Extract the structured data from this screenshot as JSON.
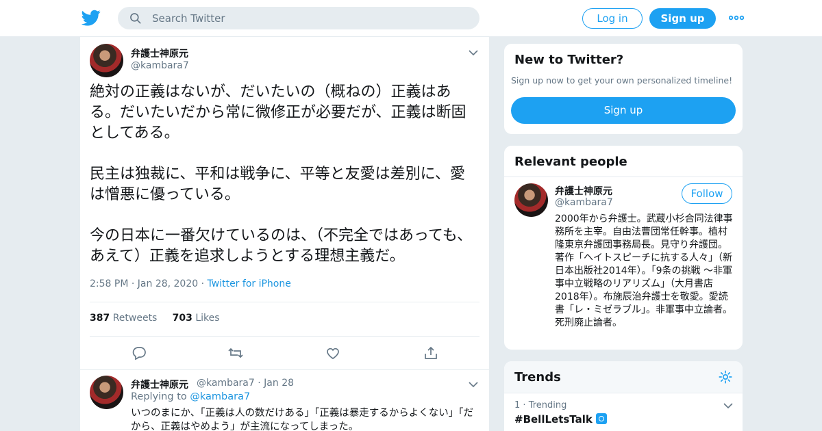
{
  "header": {
    "search_placeholder": "Search Twitter",
    "login_label": "Log in",
    "signup_label": "Sign up"
  },
  "tweet": {
    "author_name": "弁護士神原元",
    "author_handle": "@kambara7",
    "paragraphs": [
      "絶対の正義はないが、だいたいの（概ねの）正義はある。だいたいだから常に微修正が必要だが、正義は断固としてある。",
      "民主は独裁に、平和は戦争に、平等と友愛は差別に、愛は憎悪に優っている。",
      "今の日本に一番欠けているのは、（不完全ではあっても、あえて）正義を追求しようとする理想主義だ。"
    ],
    "time": "2:58 PM",
    "date": "Jan 28, 2020",
    "source": "Twitter for iPhone",
    "retweets_count": "387",
    "retweets_label": "Retweets",
    "likes_count": "703",
    "likes_label": "Likes"
  },
  "reply": {
    "author_name": "弁護士神原元",
    "author_handle": "@kambara7",
    "date": "Jan 28",
    "replying_label": "Replying to",
    "replying_handle": "@kambara7",
    "text": "いつのまにか、「正義は人の数だけある」「正義は暴走するからよくない」「だから、正義はやめよう」が主流になってしまった。"
  },
  "new_to_twitter": {
    "title": "New to Twitter?",
    "subtitle": "Sign up now to get your own personalized timeline!",
    "signup_label": "Sign up"
  },
  "relevant_people": {
    "title": "Relevant people",
    "name": "弁護士神原元",
    "handle": "@kambara7",
    "follow_label": "Follow",
    "bio": "2000年から弁護士。武蔵小杉合同法律事務所を主宰。自由法曹団常任幹事。植村隆東京弁護団事務局長。見守り弁護団。著作「ヘイトスピーチに抗する人々」（新日本出版社2014年）。「9条の挑戦 ～非軍事中立戦略のリアリズム」（大月書店2018年）。布施辰治弁護士を敬愛。愛読書「レ・ミゼラブル」。非軍事中立論者。死刑廃止論者。"
  },
  "trends": {
    "title": "Trends",
    "items": [
      {
        "rank": "1",
        "context": "Trending",
        "name": "#BellLetsTalk"
      }
    ]
  },
  "colors": {
    "accent": "#1da1f2",
    "link": "#1b95e0",
    "secondary_text": "#657786",
    "background": "#e6ecf0"
  }
}
